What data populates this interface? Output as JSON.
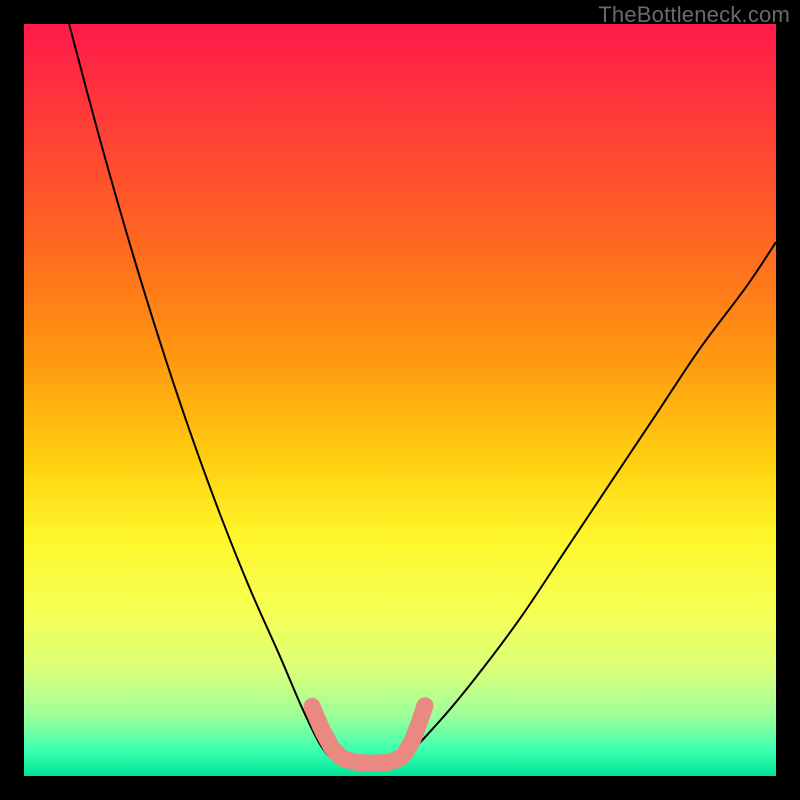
{
  "watermark": "TheBottleneck.com",
  "accent_marker_color": "#e98981",
  "curve_stroke": "#000000",
  "gradient_stops": [
    {
      "offset": 0.0,
      "color": "#ff1a4a"
    },
    {
      "offset": 0.12,
      "color": "#ff3a3a"
    },
    {
      "offset": 0.3,
      "color": "#ff6a1f"
    },
    {
      "offset": 0.45,
      "color": "#ff9a10"
    },
    {
      "offset": 0.58,
      "color": "#ffcf10"
    },
    {
      "offset": 0.68,
      "color": "#fff62a"
    },
    {
      "offset": 0.78,
      "color": "#f6ff55"
    },
    {
      "offset": 0.86,
      "color": "#d9ff7a"
    },
    {
      "offset": 0.92,
      "color": "#9dff9a"
    },
    {
      "offset": 0.965,
      "color": "#3dffb0"
    },
    {
      "offset": 1.0,
      "color": "#00e59a"
    }
  ],
  "chart_data": {
    "type": "line",
    "title": "",
    "xlabel": "",
    "ylabel": "",
    "xlim": [
      0,
      100
    ],
    "ylim": [
      0,
      100
    ],
    "legend": false,
    "grid": false,
    "notes": "Bottleneck-style V-curve; no axes shown. Values are estimated from pixel positions since the image has no ticks or labels.",
    "series": [
      {
        "name": "left-branch",
        "x": [
          6,
          10,
          14,
          18,
          22,
          26,
          30,
          34,
          37,
          39.5,
          41.5
        ],
        "y": [
          100,
          85,
          71,
          58,
          46,
          35,
          25,
          16,
          9,
          4,
          2
        ]
      },
      {
        "name": "valley",
        "x": [
          41.5,
          44,
          47,
          50
        ],
        "y": [
          2,
          1.7,
          1.7,
          2
        ]
      },
      {
        "name": "right-branch",
        "x": [
          50,
          55,
          60,
          66,
          72,
          78,
          84,
          90,
          96,
          100
        ],
        "y": [
          2,
          7,
          13,
          21,
          30,
          39,
          48,
          57,
          65,
          71
        ]
      }
    ],
    "markers": {
      "name": "highlighted-segment",
      "color": "#e98981",
      "description": "Thick rounded segment overlaid on the lower portion of the V near the minimum",
      "points_xy": [
        [
          38.2,
          9.5
        ],
        [
          39.6,
          6.2
        ],
        [
          41.0,
          3.6
        ],
        [
          42.4,
          2.3
        ],
        [
          44.2,
          1.8
        ],
        [
          46.4,
          1.7
        ],
        [
          48.6,
          1.8
        ],
        [
          50.4,
          2.6
        ],
        [
          51.6,
          4.6
        ],
        [
          52.6,
          7.2
        ],
        [
          53.4,
          9.6
        ]
      ]
    }
  }
}
